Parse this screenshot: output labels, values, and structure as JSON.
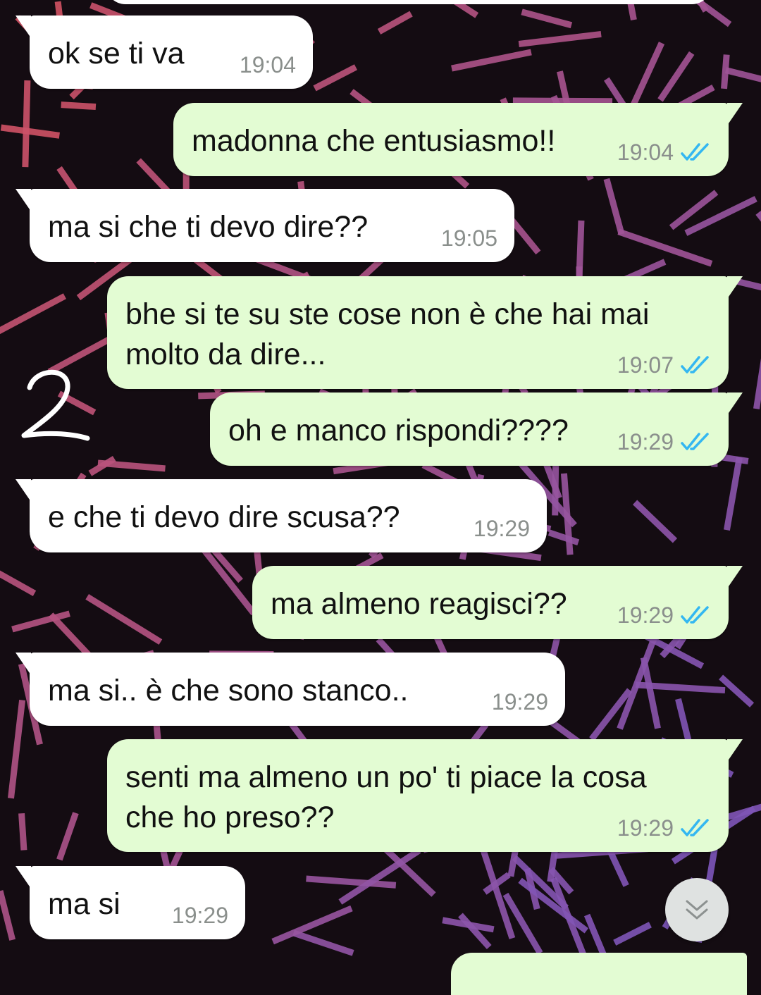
{
  "chat": {
    "messages": [
      {
        "dir": "in",
        "text": "ok se ti va",
        "time": "19:04"
      },
      {
        "dir": "out",
        "text": "madonna che entusiasmo!!",
        "time": "19:04",
        "read": true
      },
      {
        "dir": "in",
        "text": "ma si che ti devo dire??",
        "time": "19:05"
      },
      {
        "dir": "out",
        "text": "bhe si te su ste cose non è che hai mai\nmolto da dire...",
        "time": "19:07",
        "read": true
      },
      {
        "dir": "out",
        "text": "oh e manco rispondi????",
        "time": "19:29",
        "read": true
      },
      {
        "dir": "in",
        "text": "e che ti devo dire scusa??",
        "time": "19:29"
      },
      {
        "dir": "out",
        "text": "ma almeno reagisci??",
        "time": "19:29",
        "read": true
      },
      {
        "dir": "in",
        "text": "ma si.. è che sono stanco..",
        "time": "19:29"
      },
      {
        "dir": "out",
        "text": "senti ma almeno un po' ti piace la cosa\nche ho preso??",
        "time": "19:29",
        "read": true
      },
      {
        "dir": "in",
        "text": "ma si",
        "time": "19:29"
      }
    ]
  },
  "colors": {
    "incoming_bubble": "#ffffff",
    "outgoing_bubble": "#e3fcd3",
    "read_ticks": "#34b7f1",
    "wallpaper": "#140c12"
  },
  "icons": {
    "read_receipt": "double-check-icon",
    "scroll_down": "chevron-double-down-icon"
  }
}
